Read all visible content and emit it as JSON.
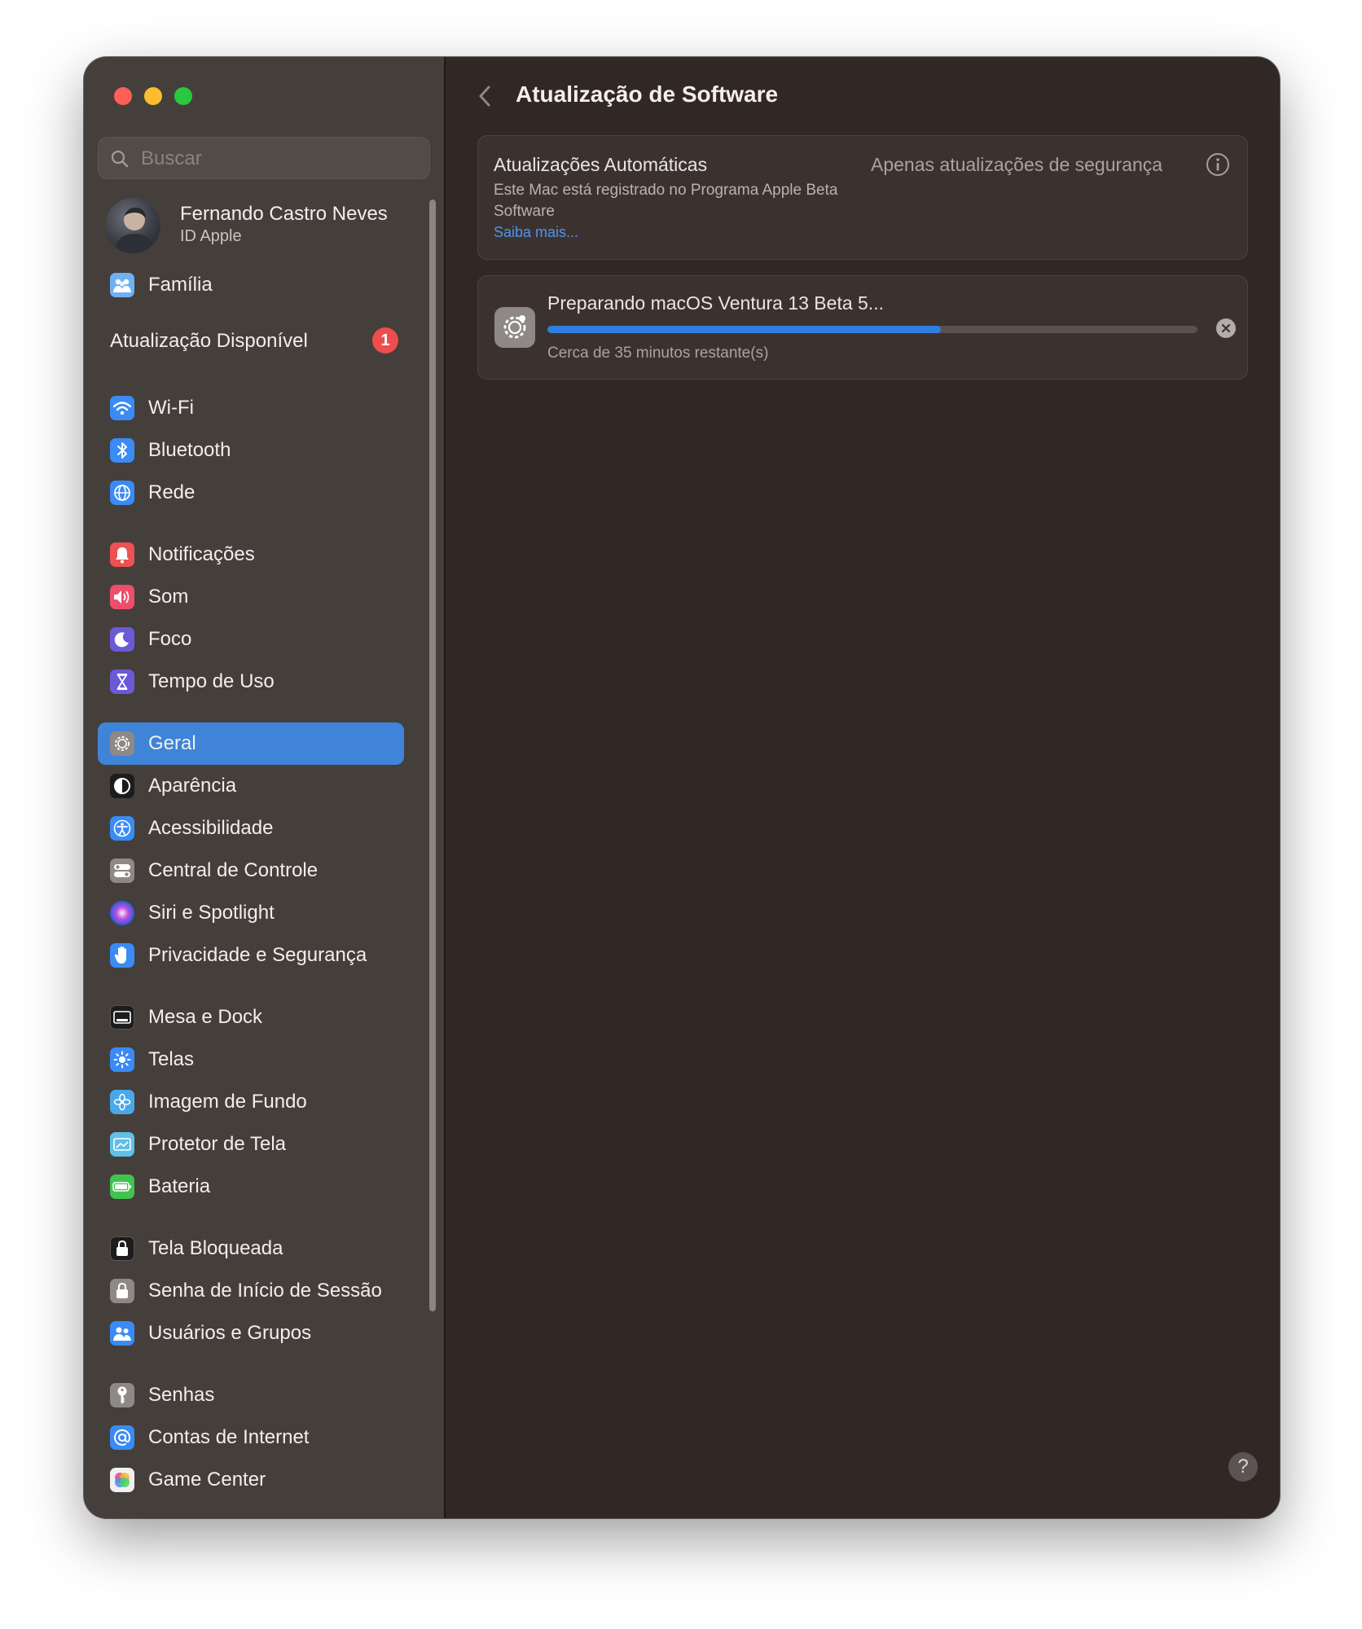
{
  "window": {
    "traffic_lights": {
      "close": "#fe5f57",
      "minimize": "#febc2e",
      "zoom": "#28c840"
    }
  },
  "sidebar": {
    "search": {
      "placeholder": "Buscar",
      "value": ""
    },
    "profile": {
      "name": "Fernando Castro Neves",
      "subtitle": "ID Apple"
    },
    "family": {
      "label": "Família",
      "icon": "family-icon"
    },
    "update_available": {
      "label": "Atualização Disponível",
      "badge": "1"
    },
    "items": [
      {
        "label": "Wi-Fi",
        "icon": "wifi-icon",
        "color": "#3a8bf5"
      },
      {
        "label": "Bluetooth",
        "icon": "bluetooth-icon",
        "color": "#3a8bf5"
      },
      {
        "label": "Rede",
        "icon": "globe-icon",
        "color": "#3a8bf5"
      },
      {
        "label": "Notificações",
        "icon": "bell-icon",
        "color": "#ee5151"
      },
      {
        "label": "Som",
        "icon": "speaker-icon",
        "color": "#ee4e6c"
      },
      {
        "label": "Foco",
        "icon": "moon-icon",
        "color": "#6a5ad8"
      },
      {
        "label": "Tempo de Uso",
        "icon": "hourglass-icon",
        "color": "#6a5ad8"
      },
      {
        "label": "Geral",
        "icon": "gear-icon",
        "color": "#8e8987",
        "selected": true
      },
      {
        "label": "Aparência",
        "icon": "appearance-icon",
        "color": "#1c1c1c"
      },
      {
        "label": "Acessibilidade",
        "icon": "accessibility-icon",
        "color": "#3a8bf5"
      },
      {
        "label": "Central de Controle",
        "icon": "control-center-icon",
        "color": "#8e8987"
      },
      {
        "label": "Siri e Spotlight",
        "icon": "siri-icon",
        "color": "#9b3fd3"
      },
      {
        "label": "Privacidade e Segurança",
        "icon": "hand-icon",
        "color": "#3a8bf5"
      },
      {
        "label": "Mesa e Dock",
        "icon": "dock-icon",
        "color": "#1c1c1c"
      },
      {
        "label": "Telas",
        "icon": "display-icon",
        "color": "#3a8bf5"
      },
      {
        "label": "Imagem de Fundo",
        "icon": "wallpaper-icon",
        "color": "#49a8e8"
      },
      {
        "label": "Protetor de Tela",
        "icon": "screensaver-icon",
        "color": "#5fc0e8"
      },
      {
        "label": "Bateria",
        "icon": "battery-icon",
        "color": "#3ec44f"
      },
      {
        "label": "Tela Bloqueada",
        "icon": "lock-screen-icon",
        "color": "#1c1c1c"
      },
      {
        "label": "Senha de Início de Sessão",
        "icon": "lock-icon",
        "color": "#8e8987"
      },
      {
        "label": "Usuários e Grupos",
        "icon": "users-icon",
        "color": "#3a8bf5"
      },
      {
        "label": "Senhas",
        "icon": "key-icon",
        "color": "#8e8987"
      },
      {
        "label": "Contas de Internet",
        "icon": "at-icon",
        "color": "#3a8bf5"
      },
      {
        "label": "Game Center",
        "icon": "game-center-icon",
        "color": "#f0f0f0"
      }
    ]
  },
  "main": {
    "title": "Atualização de Software",
    "auto_updates": {
      "title": "Atualizações Automáticas",
      "description": "Este Mac está registrado no Programa Apple Beta Software",
      "link": "Saiba mais...",
      "value": "Apenas atualizações de segurança"
    },
    "download": {
      "title": "Preparando macOS Ventura 13 Beta 5...",
      "progress": 0.605,
      "status": "Cerca de 35 minutos restante(s)"
    },
    "help_label": "?"
  }
}
